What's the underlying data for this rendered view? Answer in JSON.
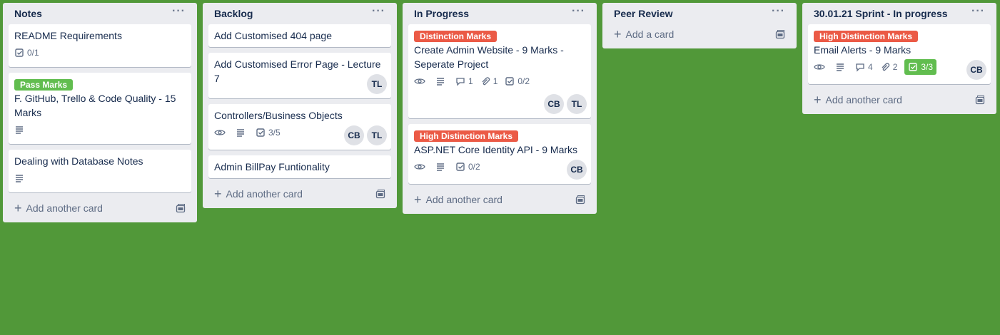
{
  "colors": {
    "board_bg": "#519839",
    "list_bg": "#ebecf0",
    "label_green": "#61bd4f",
    "label_red": "#eb5a46"
  },
  "lists": [
    {
      "title": "Notes",
      "add_label": "Add another card",
      "cards": [
        {
          "title": "README Requirements",
          "checklist": "0/1"
        },
        {
          "label": "Pass Marks",
          "title": "F. GitHub, Trello & Code Quality - 15 Marks"
        },
        {
          "title": "Dealing with Database Notes"
        }
      ]
    },
    {
      "title": "Backlog",
      "add_label": "Add another card",
      "cards": [
        {
          "title": "Add Customised 404 page"
        },
        {
          "title": "Add Customised Error Page - Lecture 7",
          "members": [
            "TL"
          ]
        },
        {
          "title": "Controllers/Business Objects",
          "checklist": "3/5",
          "members": [
            "CB",
            "TL"
          ]
        },
        {
          "title": "Admin BillPay Funtionality"
        }
      ]
    },
    {
      "title": "In Progress",
      "add_label": "Add another card",
      "cards": [
        {
          "label": "Distinction Marks",
          "title": "Create Admin Website - 9 Marks - Seperate Project",
          "comments": "1",
          "attachments": "1",
          "checklist": "0/2",
          "members": [
            "CB",
            "TL"
          ]
        },
        {
          "label": "High Distinction Marks",
          "title": "ASP.NET Core Identity API - 9 Marks",
          "checklist": "0/2",
          "members": [
            "CB"
          ]
        }
      ]
    },
    {
      "title": "Peer Review",
      "add_label": "Add a card"
    },
    {
      "title": "30.01.21 Sprint - In progress",
      "add_label": "Add another card",
      "cards": [
        {
          "label": "High Distinction Marks",
          "title": "Email Alerts - 9 Marks",
          "comments": "4",
          "attachments": "2",
          "checklist": "3/3",
          "members": [
            "CB"
          ]
        }
      ]
    }
  ]
}
